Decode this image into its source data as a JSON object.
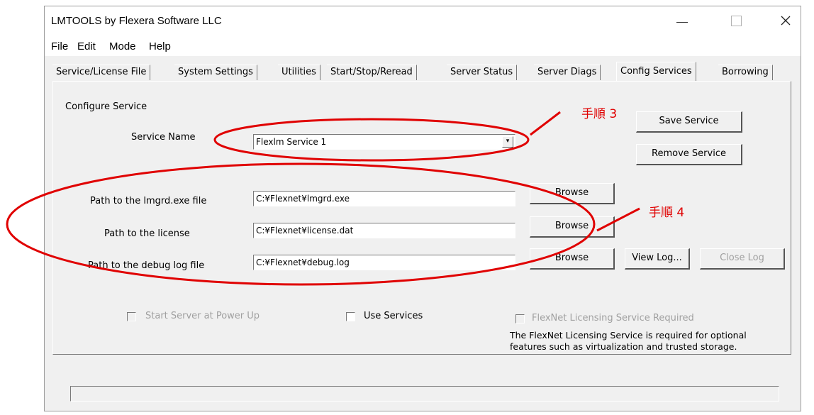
{
  "window": {
    "title": "LMTOOLS by Flexera Software LLC",
    "controls": {
      "minimize": "—",
      "maximize": "☐",
      "close": "✕"
    }
  },
  "menu": [
    "File",
    "Edit",
    "Mode",
    "Help"
  ],
  "tabs": [
    {
      "label": "Service/License File",
      "active": false
    },
    {
      "label": "System Settings",
      "active": false
    },
    {
      "label": "Utilities",
      "active": false
    },
    {
      "label": "Start/Stop/Reread",
      "active": false
    },
    {
      "label": "Server Status",
      "active": false
    },
    {
      "label": "Server Diags",
      "active": false
    },
    {
      "label": "Config Services",
      "active": true
    },
    {
      "label": "Borrowing",
      "active": false
    }
  ],
  "config": {
    "section_label": "Configure Service",
    "service_name_label": "Service Name",
    "service_name_value": "Flexlm Service 1",
    "dropdown_arrow": "▾",
    "lmgrd_label": "Path to the lmgrd.exe file",
    "lmgrd_value": "C:¥Flexnet¥lmgrd.exe",
    "license_label": "Path to the license",
    "license_value": "C:¥Flexnet¥license.dat",
    "debug_label": "Path to the debug log file",
    "debug_value": "C:¥Flexnet¥debug.log",
    "save_service": "Save Service",
    "remove_service": "Remove Service",
    "browse": "Browse",
    "view_log": "View Log...",
    "close_log": "Close Log",
    "start_at_power_up": "Start Server at Power Up",
    "use_services": "Use Services",
    "flexnet_required": "FlexNet Licensing Service Required",
    "flexnet_note_line1": "The FlexNet Licensing Service is required for optional",
    "flexnet_note_line2": "features such as virtualization and trusted storage."
  },
  "annotations": {
    "step3": "手順 3",
    "step4": "手順 4",
    "color": "#e00000"
  }
}
